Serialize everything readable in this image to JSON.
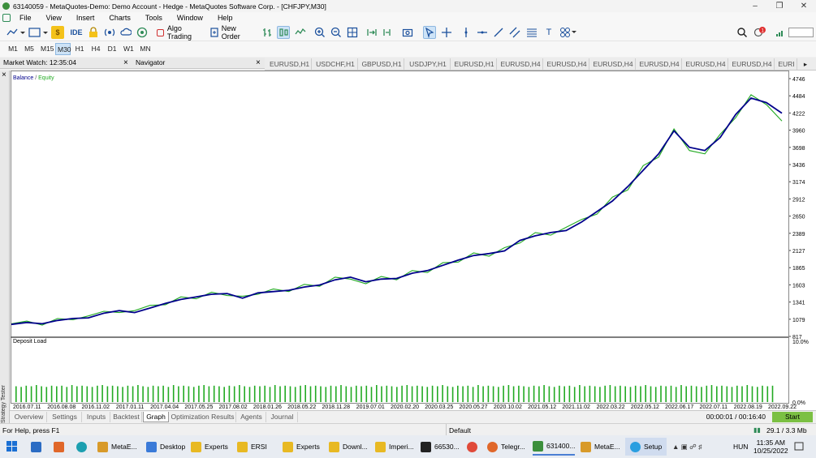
{
  "window": {
    "title": "63140059 - MetaQuotes-Demo: Demo Account - Hedge - MetaQuotes Software Corp. - [CHFJPY,M30]"
  },
  "menu": [
    "File",
    "View",
    "Insert",
    "Charts",
    "Tools",
    "Window",
    "Help"
  ],
  "toolbar": {
    "ide_label": "IDE",
    "algo_trading_label": "Algo Trading",
    "new_order_label": "New Order"
  },
  "timeframes": [
    "M1",
    "M5",
    "M15",
    "M30",
    "H1",
    "H4",
    "D1",
    "W1",
    "MN"
  ],
  "timeframe_active": "M30",
  "panels": {
    "market_watch": "Market Watch: 12:35:04",
    "navigator": "Navigator",
    "close_glyph": "×"
  },
  "chart_tabs": [
    "EURUSD,H1",
    "USDCHF,H1",
    "GBPUSD,H1",
    "USDJPY,H1",
    "EURUSD,H1",
    "EURUSD,H4",
    "EURUSD,H4",
    "EURUSD,H4",
    "EURUSD,H4",
    "EURUSD,H4",
    "EURUSD,H4",
    "EURI"
  ],
  "tester_side_label": "Strategy Tester",
  "chart_data": [
    {
      "type": "line",
      "legend": [
        "Balance",
        "Equity"
      ],
      "colors": {
        "Balance": "#00008b",
        "Equity": "#22aa22"
      },
      "y_ticks": [
        "4746",
        "4484",
        "4222",
        "3960",
        "3698",
        "3436",
        "3174",
        "2912",
        "2650",
        "2389",
        "2127",
        "1865",
        "1603",
        "1341",
        "1079",
        "817"
      ],
      "ylim": [
        817,
        4746
      ],
      "x_ticks": [
        "2016.07.11",
        "2016.08.08",
        "2016.11.02",
        "2017.01.11",
        "2017.04.04",
        "2017.05.25",
        "2017.08.02",
        "2018.01.26",
        "2018.05.22",
        "2018.11.28",
        "2019.07.01",
        "2020.02.20",
        "2020.03.25",
        "2020.05.27",
        "2020.10.02",
        "2021.05.12",
        "2021.11.02",
        "2022.03.22",
        "2022.05.12",
        "2022.06.17",
        "2022.07.11",
        "2022.08.19",
        "2022.09.22"
      ],
      "series": [
        {
          "name": "Balance",
          "values": [
            1000,
            1030,
            1010,
            1060,
            1090,
            1100,
            1170,
            1210,
            1180,
            1250,
            1320,
            1380,
            1420,
            1460,
            1470,
            1400,
            1480,
            1500,
            1520,
            1570,
            1600,
            1680,
            1720,
            1650,
            1690,
            1700,
            1780,
            1820,
            1900,
            1980,
            2050,
            2080,
            2120,
            2280,
            2350,
            2400,
            2430,
            2560,
            2720,
            2880,
            3100,
            3350,
            3600,
            3950,
            3700,
            3650,
            3850,
            4200,
            4450,
            4380,
            4220
          ]
        },
        {
          "name": "Equity",
          "values": [
            1010,
            1050,
            990,
            1090,
            1070,
            1130,
            1200,
            1180,
            1210,
            1290,
            1300,
            1420,
            1390,
            1490,
            1440,
            1430,
            1460,
            1540,
            1500,
            1610,
            1580,
            1720,
            1690,
            1620,
            1730,
            1680,
            1820,
            1790,
            1940,
            1950,
            2090,
            2040,
            2170,
            2240,
            2400,
            2360,
            2480,
            2600,
            2680,
            2940,
            3050,
            3420,
            3550,
            3980,
            3650,
            3600,
            3900,
            4150,
            4500,
            4350,
            4100
          ]
        }
      ]
    },
    {
      "type": "bar",
      "title": "Deposit Load",
      "y_ticks": [
        "10.0%",
        "0.0%"
      ],
      "ylim": [
        0,
        10
      ],
      "values": [
        2.6,
        2.5,
        2.7,
        2.6,
        2.8,
        2.6,
        2.5,
        2.7,
        2.6,
        2.7,
        2.5,
        2.8,
        2.6,
        2.7,
        2.6,
        2.5,
        2.7,
        2.8,
        2.6,
        2.7,
        2.6,
        2.5,
        2.7,
        2.6,
        2.8,
        2.6,
        2.5,
        2.7,
        2.6,
        2.7,
        2.5,
        2.8,
        2.6,
        2.7,
        2.6,
        2.5,
        2.7,
        2.8,
        2.6,
        2.7,
        2.6,
        2.5,
        2.7,
        2.6,
        2.8,
        2.6,
        2.5,
        2.7,
        2.6,
        2.7,
        2.5,
        2.8,
        2.6,
        2.7,
        2.6,
        2.5,
        2.7,
        2.8,
        2.6,
        2.7,
        2.6,
        2.5,
        2.7,
        2.6,
        2.8,
        2.6,
        2.5,
        2.7,
        2.6,
        2.7,
        2.5,
        2.8,
        2.6,
        2.7,
        2.6,
        2.5,
        2.7,
        2.8,
        2.6,
        2.7,
        2.6,
        2.5,
        2.7,
        2.6,
        2.8,
        2.6,
        2.5,
        2.7,
        2.6,
        2.7,
        2.5,
        2.8,
        2.6,
        2.7,
        2.6,
        2.5,
        2.7,
        2.8,
        2.6,
        2.7,
        2.6,
        2.5,
        2.7,
        2.6,
        2.8,
        2.6,
        2.5,
        2.7,
        2.6,
        2.7,
        2.5,
        2.8,
        2.6,
        2.7,
        2.6,
        2.5,
        2.7,
        2.8,
        2.6,
        2.7,
        2.6,
        2.5,
        2.7,
        2.6,
        2.8,
        2.6,
        2.5,
        2.7,
        2.6,
        2.7,
        2.5,
        2.8,
        2.6,
        2.7,
        2.6,
        2.5,
        2.7,
        2.8,
        2.6,
        2.7,
        2.6,
        2.5,
        2.7,
        2.6,
        2.8,
        2.6,
        2.5,
        2.7,
        2.6,
        2.7
      ]
    }
  ],
  "bottom_tabs": [
    "Overview",
    "Settings",
    "Inputs",
    "Backtest",
    "Graph",
    "Optimization Results",
    "Agents",
    "Journal"
  ],
  "bottom_tab_active": "Graph",
  "tester": {
    "elapsed": "00:00:01 / 00:16:40",
    "start_label": "Start"
  },
  "status": {
    "help": "For Help, press F1",
    "profile": "Default",
    "traffic": "29.1 / 3.3 Mb"
  },
  "taskbar": {
    "items": [
      "MetaE...",
      "Desktop",
      "Experts",
      "ERSI",
      "Experts",
      "Downl...",
      "Imperi...",
      "66530...",
      "Telegr...",
      "631400...",
      "MetaE...",
      "Setup"
    ],
    "lang": "HUN",
    "time": "11:35 AM",
    "date": "10/25/2022"
  }
}
